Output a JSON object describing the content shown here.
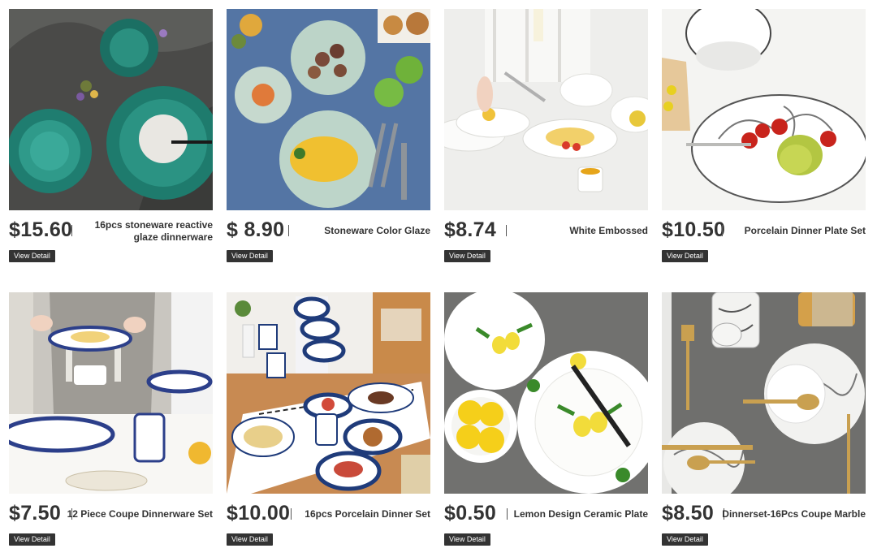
{
  "products": [
    {
      "price": "$15.60",
      "name": "16pcs  stoneware reactive glaze dinnerware",
      "button": "View Detail",
      "image": "teal-reactive-glaze-stoneware-photo"
    },
    {
      "price": "$ 8.90",
      "name": "Stoneware Color Glaze",
      "button": "View Detail",
      "image": "omelette-on-sage-plates-photo"
    },
    {
      "price": "$8.74",
      "name": "White Embossed",
      "button": "View Detail",
      "image": "white-embossed-plates-pasta-photo"
    },
    {
      "price": "$10.50",
      "name": "Porcelain Dinner Plate Set",
      "button": "View Detail",
      "image": "sketch-porcelain-bowl-fruit-photo"
    },
    {
      "price": "$7.50",
      "name": "12 Piece Coupe Dinnerware Set",
      "button": "View Detail",
      "image": "blue-pattern-dinnerware-apron-photo"
    },
    {
      "price": "$10.00",
      "name": "16pcs Porcelain Dinner Set",
      "button": "View Detail",
      "image": "blue-dot-porcelain-table-photo"
    },
    {
      "price": "$0.50",
      "name": "Lemon Design Ceramic Plate",
      "button": "View Detail",
      "image": "lemon-ceramic-plates-photo"
    },
    {
      "price": "$8.50",
      "name": "Dinnerset-16Pcs Coupe Marble",
      "button": "View Detail",
      "image": "marble-coupe-gold-cutlery-photo"
    }
  ]
}
